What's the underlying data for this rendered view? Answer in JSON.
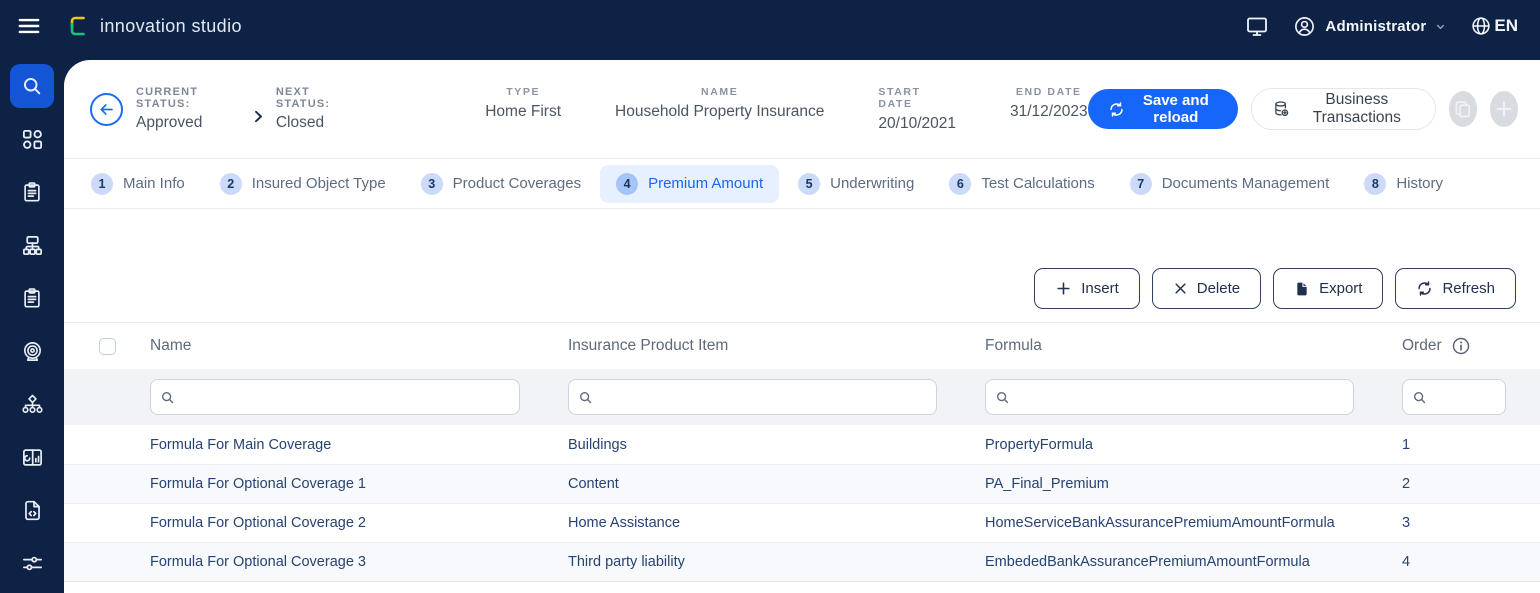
{
  "topbar": {
    "brand": "innovation studio",
    "user": "Administrator",
    "language": "EN"
  },
  "sidebar": {
    "items": [
      {
        "id": "search",
        "icon": "search",
        "active": true
      },
      {
        "id": "modules",
        "icon": "modules",
        "active": false
      },
      {
        "id": "tasks",
        "icon": "clipboard",
        "active": false
      },
      {
        "id": "process-flow",
        "icon": "flow",
        "active": false
      },
      {
        "id": "forms",
        "icon": "clipboard",
        "active": false
      },
      {
        "id": "goals",
        "icon": "target",
        "active": false
      },
      {
        "id": "hierarchy",
        "icon": "hierarchy",
        "active": false
      },
      {
        "id": "dashboard",
        "icon": "dashboard",
        "active": false
      },
      {
        "id": "document-code",
        "icon": "doc-code",
        "active": false
      },
      {
        "id": "settings",
        "icon": "sliders",
        "active": false
      }
    ]
  },
  "header": {
    "current_status": {
      "label": "CURRENT STATUS:",
      "value": "Approved"
    },
    "next_status": {
      "label": "NEXT STATUS:",
      "value": "Closed"
    },
    "fields": [
      {
        "label": "TYPE",
        "value": "Home First"
      },
      {
        "label": "NAME",
        "value": "Household Property Insurance"
      },
      {
        "label": "START DATE",
        "value": "20/10/2021"
      },
      {
        "label": "END DATE",
        "value": "31/12/2023"
      }
    ],
    "save_button": "Save and reload",
    "business_transactions_button": "Business Transactions"
  },
  "tabs": [
    {
      "number": "1",
      "label": "Main Info",
      "active": false
    },
    {
      "number": "2",
      "label": "Insured Object Type",
      "active": false
    },
    {
      "number": "3",
      "label": "Product Coverages",
      "active": false
    },
    {
      "number": "4",
      "label": "Premium Amount",
      "active": true
    },
    {
      "number": "5",
      "label": "Underwriting",
      "active": false
    },
    {
      "number": "6",
      "label": "Test Calculations",
      "active": false
    },
    {
      "number": "7",
      "label": "Documents Management",
      "active": false
    },
    {
      "number": "8",
      "label": "History",
      "active": false
    }
  ],
  "toolbar": {
    "buttons": [
      {
        "id": "insert",
        "label": "Insert",
        "icon": "plus"
      },
      {
        "id": "delete",
        "label": "Delete",
        "icon": "x"
      },
      {
        "id": "export",
        "label": "Export",
        "icon": "file"
      },
      {
        "id": "refresh",
        "label": "Refresh",
        "icon": "refresh"
      }
    ]
  },
  "table": {
    "columns": [
      {
        "id": "name",
        "label": "Name",
        "info": false
      },
      {
        "id": "insurance_product_item",
        "label": "Insurance Product Item",
        "info": false
      },
      {
        "id": "formula",
        "label": "Formula",
        "info": false
      },
      {
        "id": "order",
        "label": "Order",
        "info": true
      }
    ],
    "rows": [
      {
        "name": "Formula For Main Coverage",
        "insurance_product_item": "Buildings",
        "formula": "PropertyFormula",
        "order": "1"
      },
      {
        "name": "Formula For Optional Coverage 1",
        "insurance_product_item": "Content",
        "formula": "PA_Final_Premium",
        "order": "2"
      },
      {
        "name": "Formula For Optional Coverage 2",
        "insurance_product_item": "Home Assistance",
        "formula": "HomeServiceBankAssurancePremiumAmountFormula",
        "order": "3"
      },
      {
        "name": "Formula For Optional Coverage 3",
        "insurance_product_item": "Third party liability",
        "formula": "EmbededBankAssurancePremiumAmountFormula",
        "order": "4"
      }
    ]
  },
  "colors": {
    "topbar_navy": "#0d2245",
    "primary_blue": "#1766fa",
    "sidebar_active_blue": "#1355d4",
    "tab_active_bg": "#e7f0fe",
    "tab_active_text": "#1a66f5",
    "row_text_blue": "#274371",
    "filter_row_bg": "#f1f3f6",
    "logo_yellow": "#f5c518",
    "logo_green": "#17c37b"
  }
}
